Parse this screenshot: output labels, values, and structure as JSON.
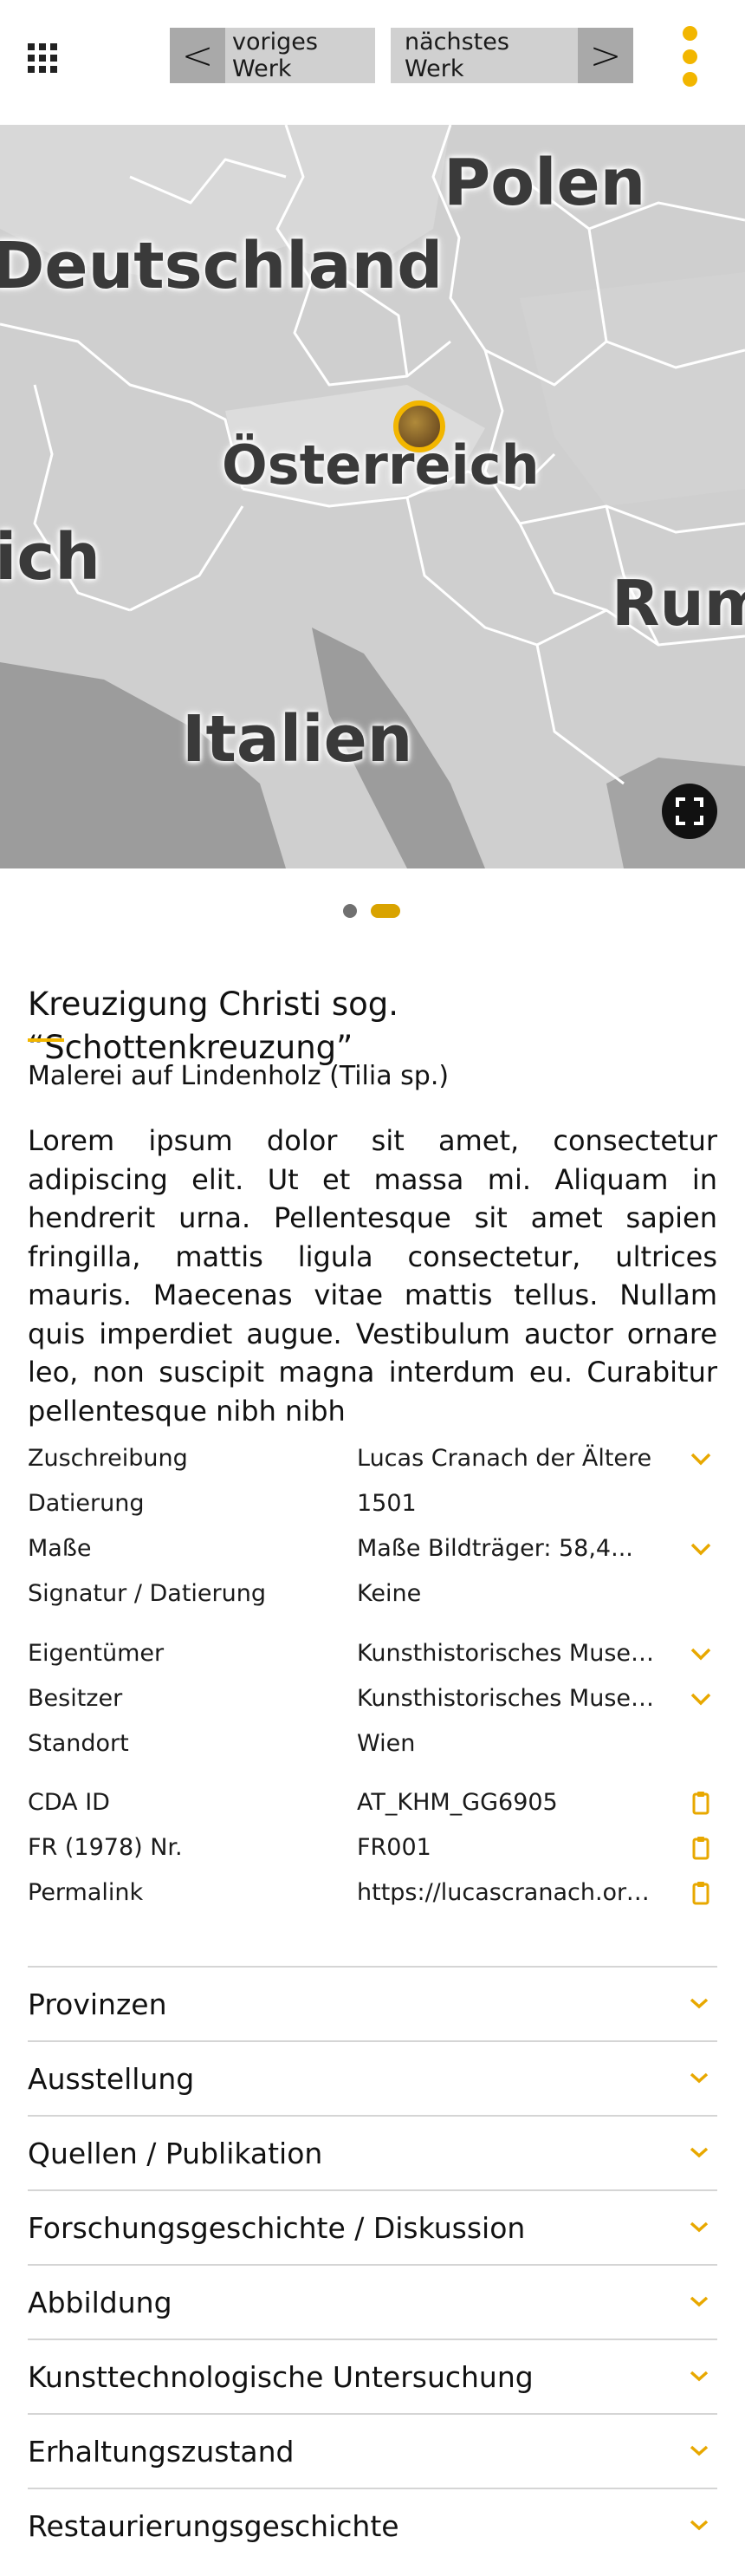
{
  "header": {
    "menu_icon": "grid-icon",
    "prev_arrow": "<",
    "prev_label": "voriges Werk",
    "next_label": "nächstes Werk",
    "next_arrow": ">",
    "more_icon": "kebab-icon",
    "accent_color": "#f2b600"
  },
  "map": {
    "labels": {
      "polen": "Polen",
      "deutschland": "Deutschland",
      "oesterreich": "Österreich",
      "ich": "ich",
      "rum": "Rum",
      "italien": "Italien"
    },
    "marker_icon": "artwork-marker-icon",
    "fullscreen_icon": "fullscreen-icon"
  },
  "carousel": {
    "slide_count": 2,
    "active_index": 1
  },
  "artwork": {
    "title": "Kreuzigung Christi sog. “Schottenkreuzung”",
    "medium": "Malerei auf Lindenholz (Tilia sp.)",
    "description": "Lorem ipsum dolor sit amet, consectetur adipiscing elit. Ut et massa mi. Aliquam in hendrerit urna. Pellentesque sit amet sapien fringilla, mattis ligula consectetur, ultrices mauris. Maecenas vitae mattis tellus. Nullam quis imperdiet augue. Vestibulum auctor ornare leo, non suscipit magna interdum eu. Curabitur pellentesque nibh nibh"
  },
  "metadata": [
    {
      "label": "Zuschreibung",
      "value": "Lucas Cranach der Ältere",
      "action": "chevron-down-icon"
    },
    {
      "label": "Datierung",
      "value": "1501",
      "action": ""
    },
    {
      "label": "Maße",
      "value": "Maße Bildträger: 58,4...",
      "action": "chevron-down-icon"
    },
    {
      "label": "Signatur / Datierung",
      "value": "Keine",
      "action": ""
    },
    {
      "label": "Eigentümer",
      "value": "Kunsthistorisches Museu...",
      "action": "chevron-down-icon"
    },
    {
      "label": "Besitzer",
      "value": "Kunsthistorisches Museu...",
      "action": "chevron-down-icon"
    },
    {
      "label": "Standort",
      "value": "Wien",
      "action": ""
    },
    {
      "label": "CDA ID",
      "value": "AT_KHM_GG6905",
      "action": "clipboard-icon"
    },
    {
      "label": "FR (1978) Nr.",
      "value": "FR001",
      "action": "clipboard-icon"
    },
    {
      "label": "Permalink",
      "value": "https://lucascranach.org/...",
      "action": "clipboard-icon"
    }
  ],
  "sections": [
    {
      "label": "Provinzen"
    },
    {
      "label": "Ausstellung"
    },
    {
      "label": "Quellen / Publikation"
    },
    {
      "label": "Forschungsgeschichte / Diskussion"
    },
    {
      "label": "Abbildung"
    },
    {
      "label": "Kunsttechnologische Untersuchung"
    },
    {
      "label": "Erhaltungszustand"
    },
    {
      "label": "Restaurierungsgeschichte"
    }
  ]
}
